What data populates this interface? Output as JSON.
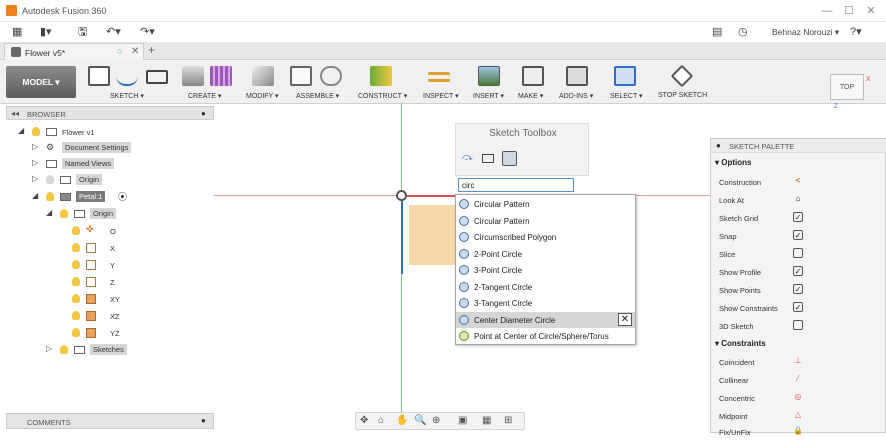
{
  "app": {
    "title": "Autodesk Fusion 360"
  },
  "window_controls": {
    "minimize": "—",
    "maximize": "☐",
    "close": "✕"
  },
  "menubar": {
    "grid": "▦",
    "file": "▮▾",
    "save": "🖫",
    "undo": "↶▾",
    "redo": "↷▾",
    "job": "▤",
    "clock": "◷",
    "user": "Behnaz Norouzi ▾",
    "help": "?▾"
  },
  "tab": {
    "label": "Flower v5*",
    "close": "✕",
    "plus": "+"
  },
  "ribbon": {
    "model": "MODEL ▾",
    "groups": [
      "SKETCH ▾",
      "CREATE ▾",
      "MODIFY ▾",
      "ASSEMBLE ▾",
      "CONSTRUCT ▾",
      "INSPECT ▾",
      "INSERT ▾",
      "MAKE ▾",
      "ADD-INS ▾",
      "SELECT ▾",
      "STOP SKETCH"
    ]
  },
  "viewcube": {
    "face": "TOP",
    "x": "X",
    "z": "Z"
  },
  "browser": {
    "header": "BROWSER",
    "root": "Flower v1",
    "doc_settings": "Document Settings",
    "named_views": "Named Views",
    "origin": "Origin",
    "petal": "Petal:1",
    "petal_origin": "Origin",
    "o": "O",
    "x": "X",
    "y": "Y",
    "z": "Z",
    "xy": "XY",
    "xz": "XZ",
    "yz": "YZ",
    "sketches": "Sketches"
  },
  "comments": {
    "label": "COMMENTS"
  },
  "sketch_toolbox": {
    "title": "Sketch Toolbox",
    "search_value": "circ"
  },
  "dropdown": {
    "items": [
      "Circular Pattern",
      "Circular Pattern",
      "Circumscribed Polygon",
      "2-Point Circle",
      "3-Point Circle",
      "2-Tangent Circle",
      "3-Tangent Circle",
      "Center Diameter Circle",
      "Point at Center of Circle/Sphere/Torus"
    ],
    "selected_index": 7,
    "clear": "✕"
  },
  "palette": {
    "header": "SKETCH PALETTE",
    "options_title": "▾ Options",
    "options": [
      {
        "label": "Construction",
        "control": "<"
      },
      {
        "label": "Look At",
        "control": "⌂"
      },
      {
        "label": "Sketch Grid",
        "control": "✓"
      },
      {
        "label": "Snap",
        "control": "✓"
      },
      {
        "label": "Slice",
        "control": ""
      },
      {
        "label": "Show Profile",
        "control": "✓"
      },
      {
        "label": "Show Points",
        "control": "✓"
      },
      {
        "label": "Show Constraints",
        "control": "✓"
      },
      {
        "label": "3D Sketch",
        "control": ""
      }
    ],
    "constraints_title": "▾ Constraints",
    "constraints": [
      {
        "label": "Coincident",
        "control": "⊥"
      },
      {
        "label": "Collinear",
        "control": "⁄"
      },
      {
        "label": "Concentric",
        "control": "◎"
      },
      {
        "label": "Midpoint",
        "control": "△"
      },
      {
        "label": "Fix/UnFix",
        "control": "🔒"
      }
    ]
  },
  "colors": {
    "accent_orange": "#f0801a",
    "sketch_red": "#d9534f",
    "sketch_blue": "#2f6fbf",
    "face": "#f5d9a8",
    "axis_green": "#7ec87e"
  }
}
